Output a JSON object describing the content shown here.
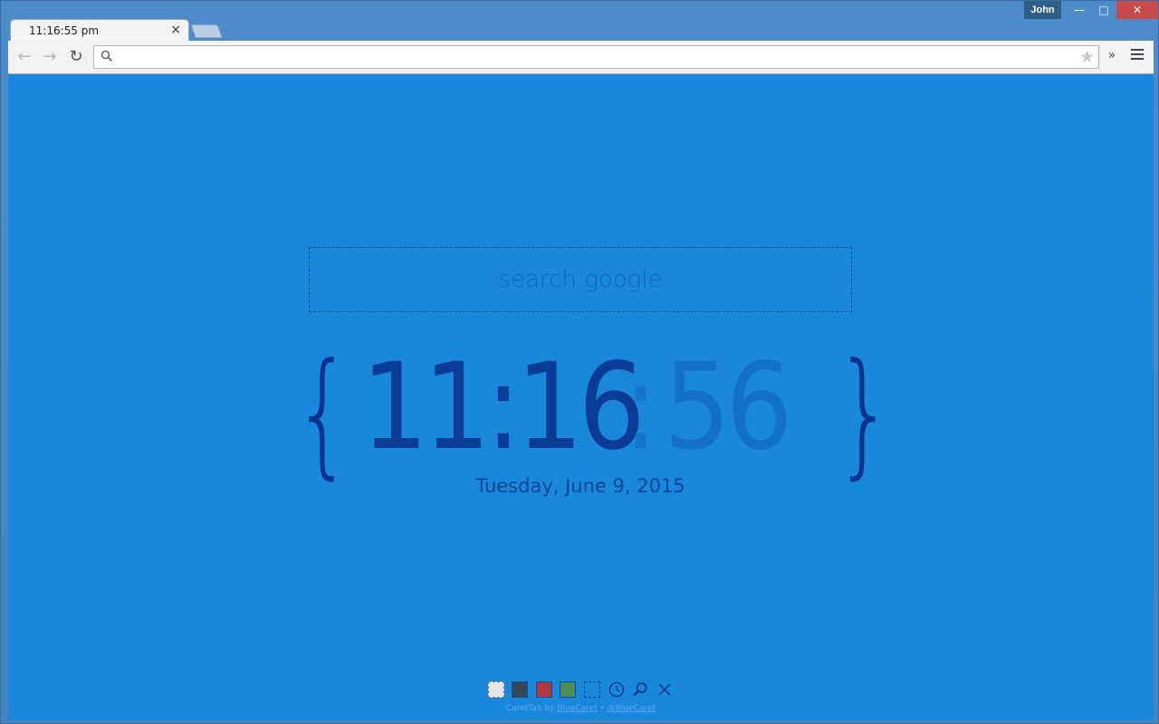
{
  "window": {
    "profile_name": "John",
    "min_symbol": "—",
    "max_symbol": "□",
    "close_symbol": "✕"
  },
  "tab": {
    "title": "11:16:55 pm",
    "close_symbol": "×"
  },
  "toolbar": {
    "back_symbol": "←",
    "forward_symbol": "→",
    "reload_symbol": "↻",
    "omnibox_value": "",
    "bookmark_symbol": "★",
    "extensions_symbol": "»"
  },
  "page": {
    "search_placeholder": "search google",
    "brace_open": "{",
    "brace_close": "}",
    "clock_hours_minutes": "11:16",
    "clock_colon": ":",
    "clock_seconds": "56",
    "date": "Tuesday, June 9, 2015",
    "palette": [
      {
        "name": "light",
        "color": "#e5e5e5"
      },
      {
        "name": "dark",
        "color": "#3a4752"
      },
      {
        "name": "red",
        "color": "#b2383e"
      },
      {
        "name": "green",
        "color": "#4d8c57"
      },
      {
        "name": "blue",
        "color": "#1a88da"
      }
    ],
    "footer_prefix": "CaretTab by ",
    "footer_link1": "BlueCaret",
    "footer_sep": " • ",
    "footer_link2": "@BlueCaret"
  },
  "colors": {
    "background": "#1a88da",
    "clock_primary": "#0a3c96",
    "clock_seconds": "#1371c9"
  }
}
